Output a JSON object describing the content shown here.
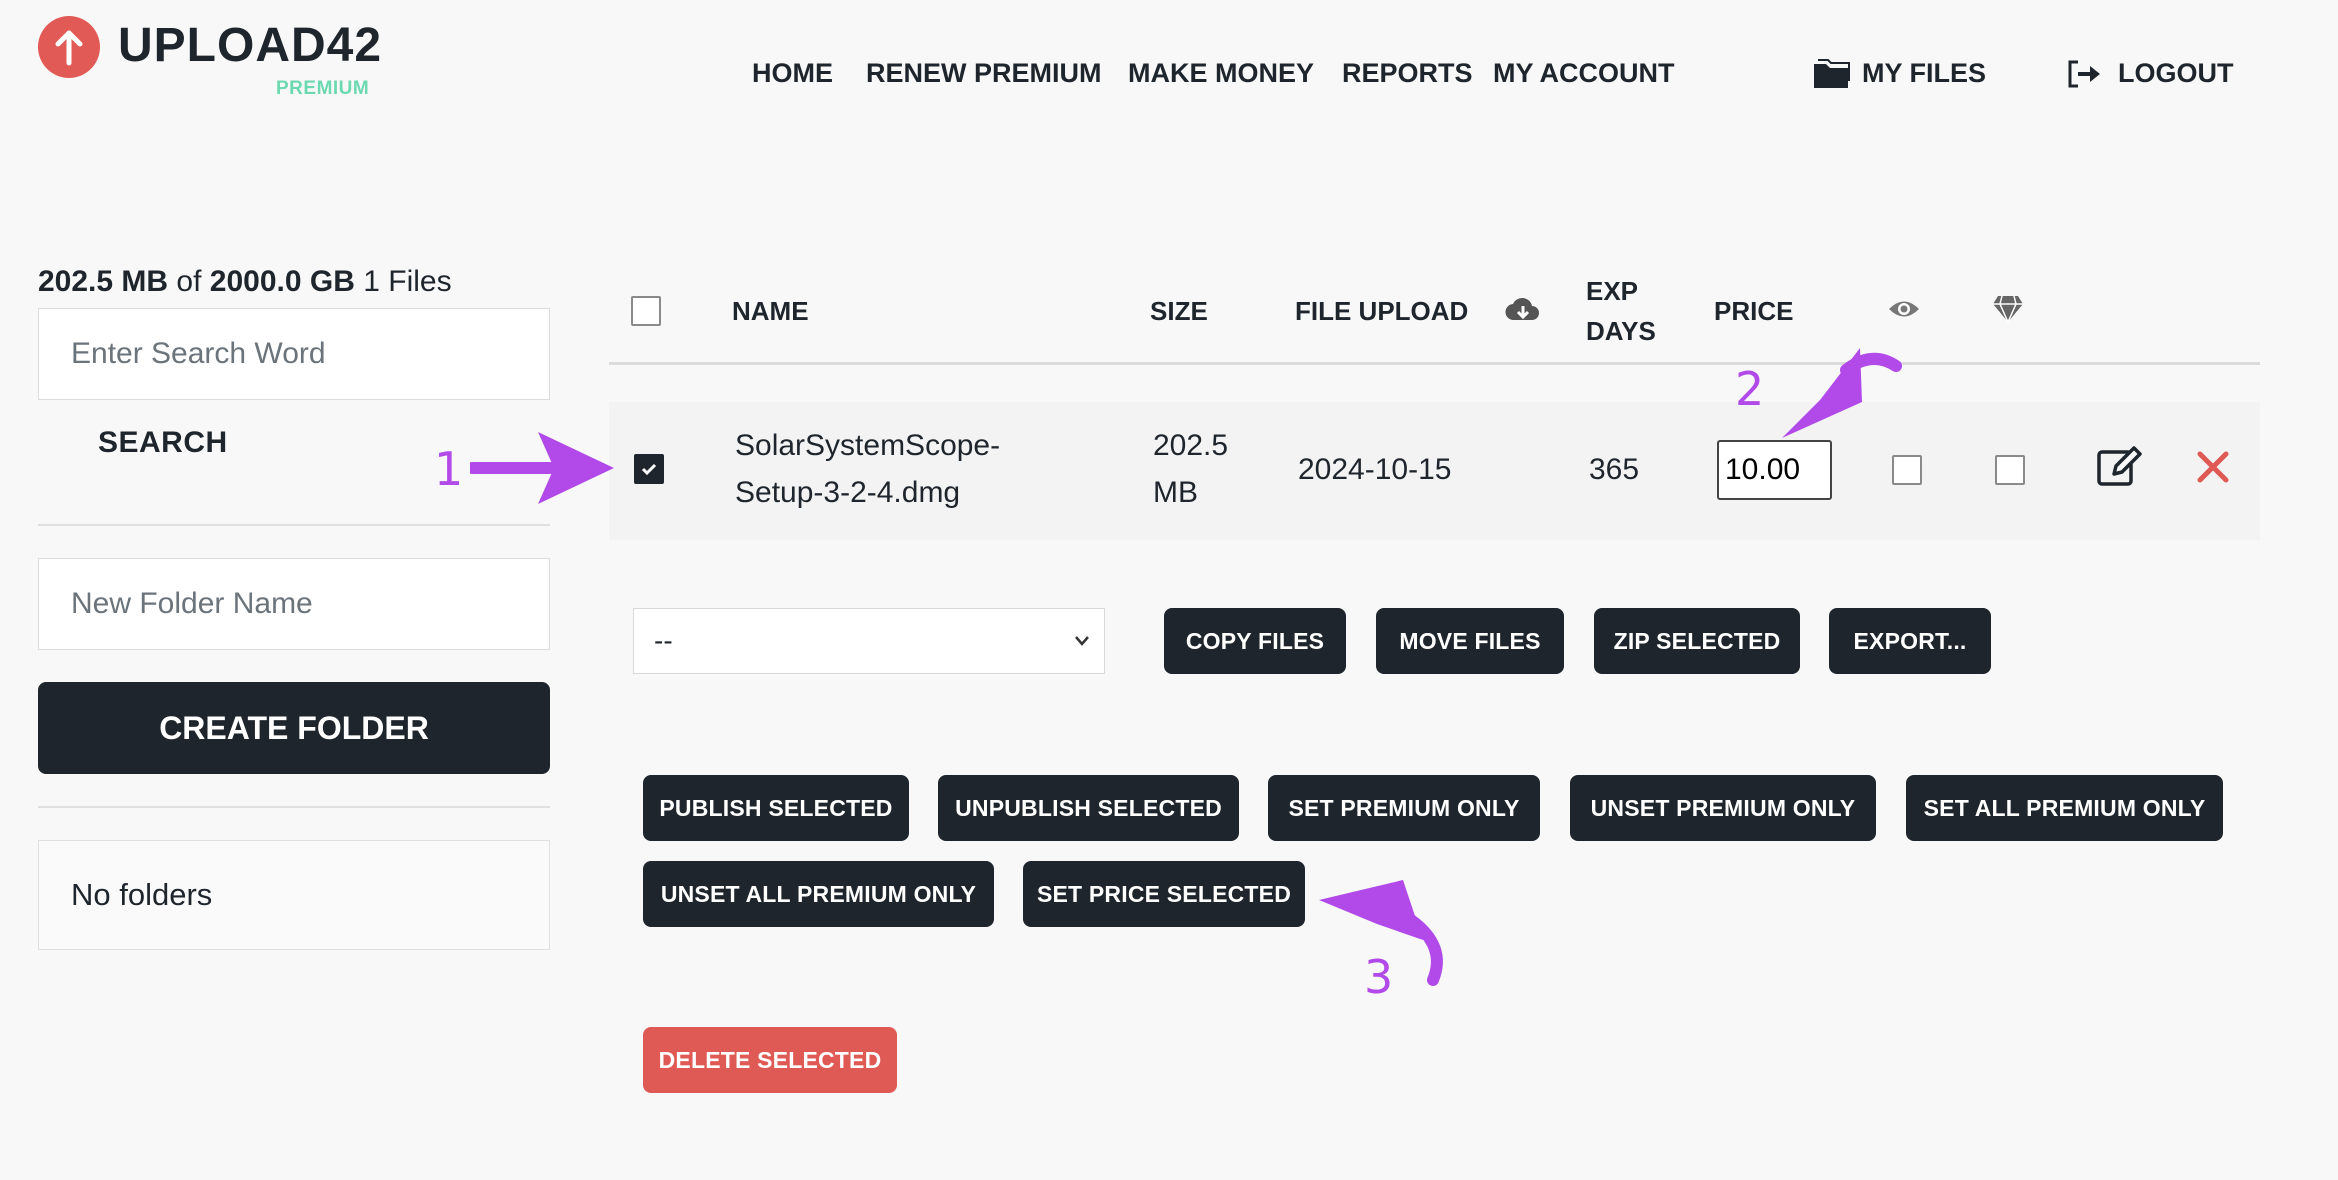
{
  "brand": {
    "name": "UPLOAD42",
    "tagline": "PREMIUM",
    "logo_color": "#e25a55",
    "tagline_color": "#6cd9b0"
  },
  "nav": {
    "items": [
      "HOME",
      "RENEW PREMIUM",
      "MAKE MONEY",
      "REPORTS",
      "MY ACCOUNT"
    ],
    "my_files": "MY FILES",
    "logout": "LOGOUT"
  },
  "sidebar": {
    "storage_used": "202.5 MB",
    "storage_of": "of",
    "storage_total": "2000.0 GB",
    "file_count": "1 Files",
    "search_placeholder": "Enter Search Word",
    "search_label": "SEARCH",
    "folder_placeholder": "New Folder Name",
    "create_folder_label": "CREATE FOLDER",
    "no_folders": "No folders"
  },
  "table": {
    "headers": {
      "name": "NAME",
      "size": "SIZE",
      "file_upload": "FILE UPLOAD",
      "exp_line1": "EXP",
      "exp_line2": "DAYS",
      "price": "PRICE"
    },
    "rows": [
      {
        "checked": true,
        "name_line1": "SolarSystemScope-",
        "name_line2": "Setup-3-2-4.dmg",
        "size_line1": "202.5",
        "size_line2": "MB",
        "upload_date": "2024-10-15",
        "exp_days": "365",
        "price": "10.00",
        "published": false,
        "premium_only": false
      }
    ]
  },
  "actions": {
    "folder_select": "--",
    "copy": "COPY FILES",
    "move": "MOVE FILES",
    "zip": "ZIP SELECTED",
    "export": "EXPORT...",
    "publish": "PUBLISH SELECTED",
    "unpublish": "UNPUBLISH SELECTED",
    "set_premium": "SET PREMIUM ONLY",
    "unset_premium": "UNSET PREMIUM ONLY",
    "set_all_premium": "SET ALL PREMIUM ONLY",
    "unset_all_premium": "UNSET ALL PREMIUM ONLY",
    "set_price": "SET PRICE SELECTED",
    "delete": "DELETE SELECTED"
  },
  "annotations": {
    "step1": "1",
    "step2": "2",
    "step3": "3",
    "color": "#b14ae8"
  }
}
